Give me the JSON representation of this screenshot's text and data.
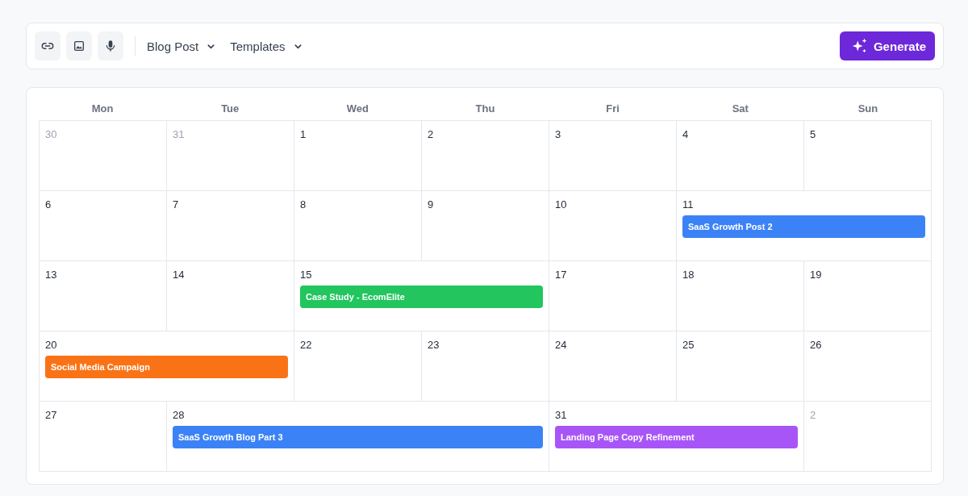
{
  "toolbar": {
    "icon_buttons": [
      {
        "kind": "link"
      },
      {
        "kind": "image"
      },
      {
        "kind": "mic"
      }
    ],
    "dropdowns": [
      {
        "label": "Blog Post"
      },
      {
        "label": "Templates"
      }
    ],
    "generate_button": {
      "label": "Generate"
    }
  },
  "calendar": {
    "weekdays": [
      "Mon",
      "Tue",
      "Wed",
      "Thu",
      "Fri",
      "Sat",
      "Sun"
    ],
    "weeks": [
      {
        "cells": [
          {
            "day": "30",
            "muted": true
          },
          {
            "day": "31",
            "muted": true
          },
          {
            "day": "1",
            "muted": false
          },
          {
            "day": "2",
            "muted": false
          },
          {
            "day": "3",
            "muted": false
          },
          {
            "day": "4",
            "muted": false
          },
          {
            "day": "5",
            "muted": false
          }
        ]
      },
      {
        "cells": [
          {
            "day": "6",
            "muted": false
          },
          {
            "day": "7",
            "muted": false
          },
          {
            "day": "8",
            "muted": false
          },
          {
            "day": "9",
            "muted": false
          },
          {
            "day": "10",
            "muted": false
          },
          {
            "day": "11",
            "muted": false,
            "event": {
              "title": "SaaS Growth Post 2",
              "color": "#3b82f6"
            }
          }
        ]
      },
      {
        "cells": [
          {
            "day": "13",
            "muted": false
          },
          {
            "day": "14",
            "muted": false
          },
          {
            "day": "15",
            "muted": false,
            "event": {
              "title": "Case Study - EcomElite",
              "color": "#22c55e"
            }
          },
          {
            "day": "17",
            "muted": false
          },
          {
            "day": "18",
            "muted": false
          },
          {
            "day": "19",
            "muted": false
          }
        ]
      },
      {
        "cells": [
          {
            "day": "20",
            "muted": false,
            "event": {
              "title": "Social Media Campaign",
              "color": "#f97316"
            }
          },
          {
            "day": "22",
            "muted": false
          },
          {
            "day": "23",
            "muted": false
          },
          {
            "day": "24",
            "muted": false
          },
          {
            "day": "25",
            "muted": false
          },
          {
            "day": "26",
            "muted": false
          }
        ]
      },
      {
        "cells": [
          {
            "day": "27",
            "muted": false
          },
          {
            "day": "28",
            "muted": false,
            "event": {
              "title": "SaaS Growth Blog Part 3",
              "color": "#3b82f6"
            }
          },
          {
            "day": "31",
            "muted": false,
            "event": {
              "title": "Landing Page Copy Refinement",
              "color": "#a855f7"
            }
          },
          {
            "day": "2",
            "muted": true
          }
        ]
      }
    ]
  }
}
